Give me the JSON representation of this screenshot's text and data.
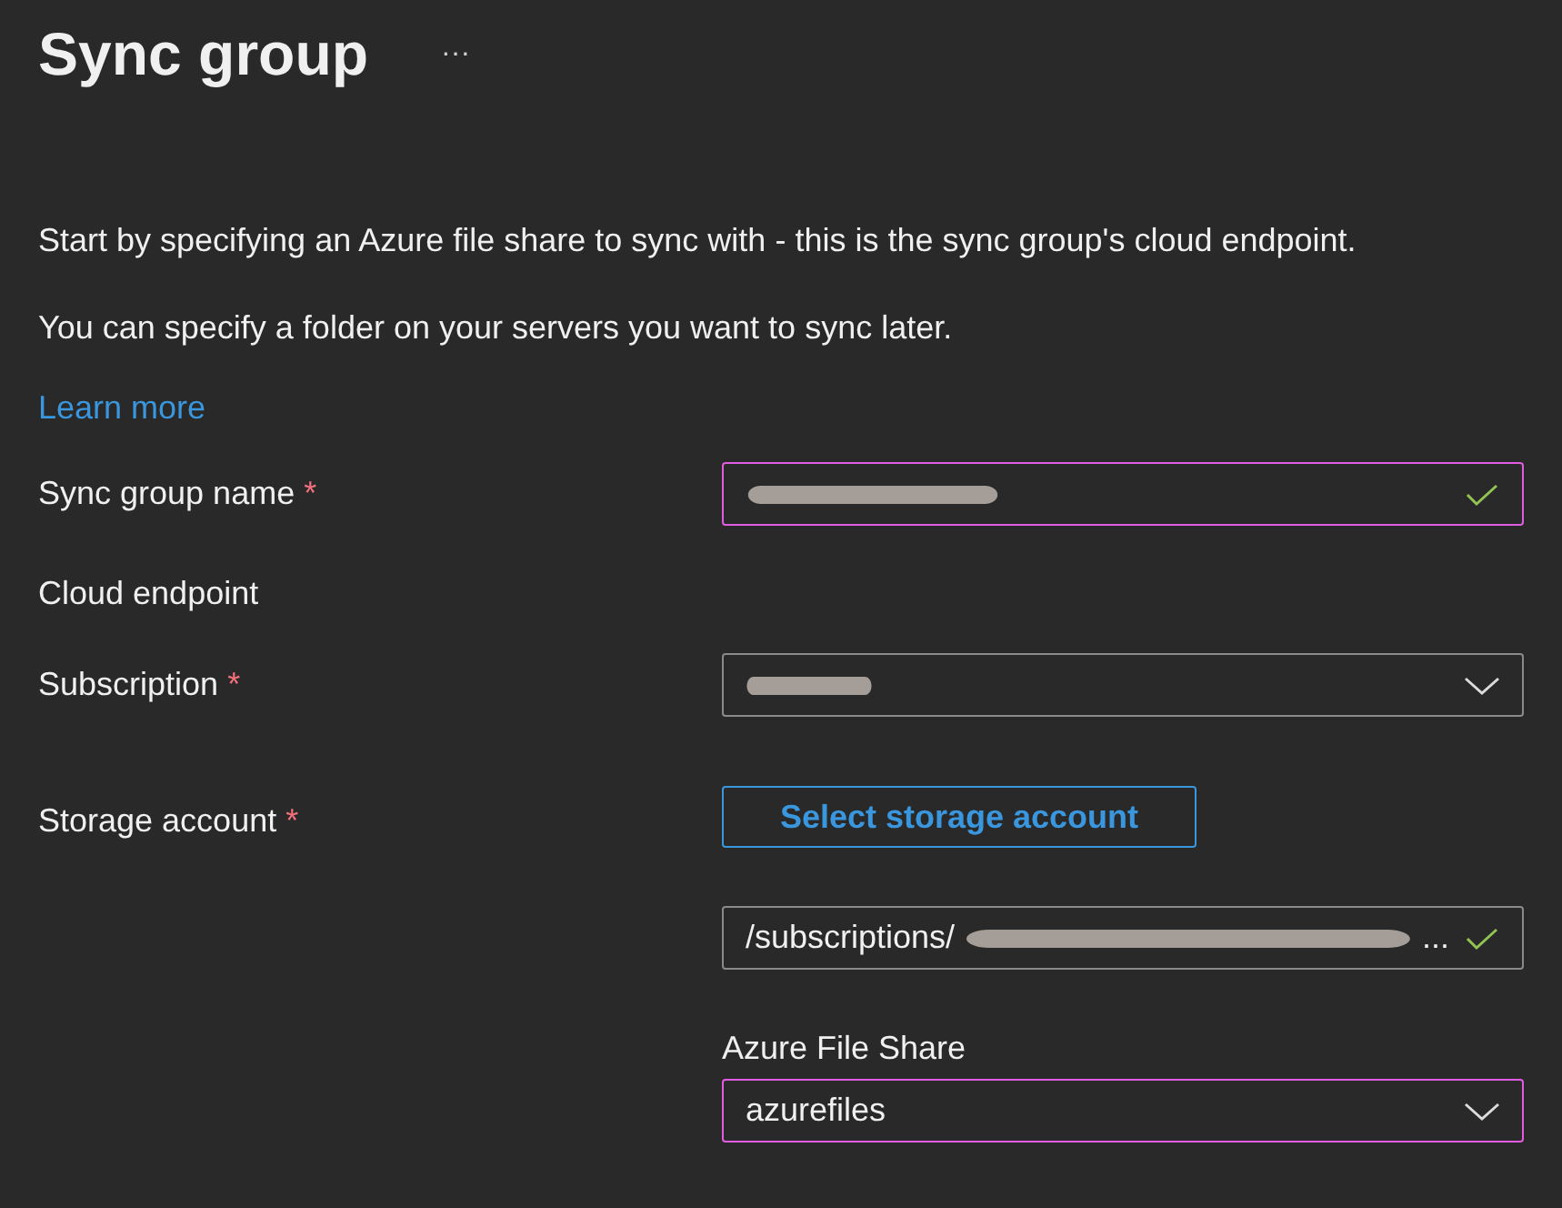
{
  "title": "Sync group",
  "more": "···",
  "intro": [
    "Start by specifying an Azure file share to sync with - this is the sync group's cloud endpoint.",
    "You can specify a folder on your servers you want to sync later."
  ],
  "learn_more": "Learn more",
  "rows": [
    {
      "kind": "field",
      "label": "Sync group name",
      "required_mark": "*",
      "field": {
        "kind": "text",
        "redacted": true,
        "highlighted": true,
        "valid": true
      }
    },
    {
      "kind": "section",
      "label": "Cloud endpoint"
    },
    {
      "kind": "field",
      "label": "Subscription",
      "required_mark": "*",
      "field": {
        "kind": "dropdown",
        "redacted": true,
        "highlighted": false,
        "valid": false
      }
    },
    {
      "kind": "storage",
      "label": "Storage account",
      "required_mark": "*",
      "button": "Select storage account",
      "field": {
        "kind": "text",
        "value": "/subscriptions/",
        "redacted": true,
        "ellipsis": "...",
        "highlighted": false,
        "valid": true
      },
      "share_label": "Azure File Share",
      "share": {
        "kind": "dropdown",
        "value": "azurefiles",
        "redacted": false,
        "highlighted": true,
        "valid": false
      }
    }
  ]
}
